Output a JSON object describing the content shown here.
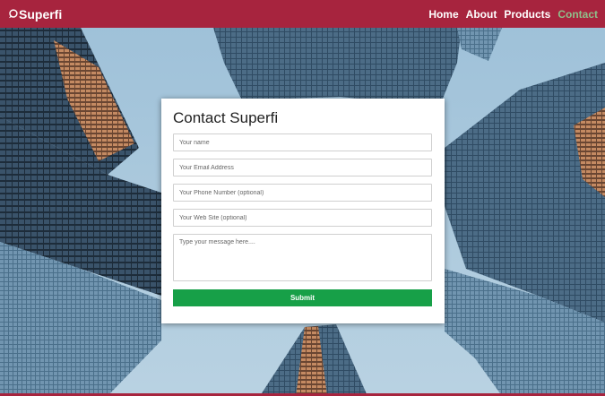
{
  "navbar": {
    "brand": "Superfi",
    "brand_icon": "chat-bubble-icon",
    "links": [
      {
        "label": "Home",
        "active": false
      },
      {
        "label": "About",
        "active": false
      },
      {
        "label": "Products",
        "active": false
      },
      {
        "label": "Contact",
        "active": true
      }
    ],
    "background_color": "#a7243e",
    "active_link_color": "#8fbf8a"
  },
  "contact_form": {
    "title": "Contact Superfi",
    "name_placeholder": "Your name",
    "email_placeholder": "Your Email Address",
    "phone_placeholder": "Your Phone Number (optional)",
    "website_placeholder": "Your Web Site (optional)",
    "message_placeholder": "Type your message here....",
    "submit_label": "Submit",
    "submit_color": "#17a048"
  }
}
